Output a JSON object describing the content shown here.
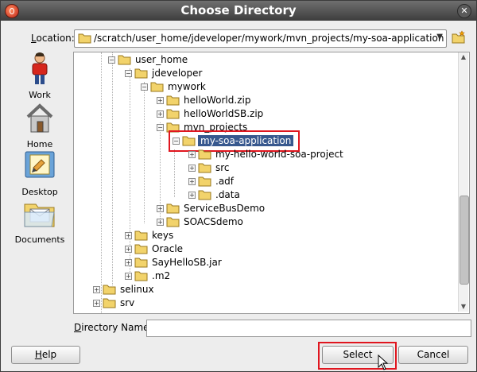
{
  "window": {
    "title": "Choose Directory"
  },
  "location": {
    "label_underlined": "L",
    "label_rest": "ocation:",
    "value": "/scratch/user_home/jdeveloper/mywork/mvn_projects/my-soa-application"
  },
  "shortcuts": [
    {
      "label": "Work",
      "icon": "work-icon"
    },
    {
      "label": "Home",
      "icon": "home-icon"
    },
    {
      "label": "Desktop",
      "icon": "desktop-icon"
    },
    {
      "label": "Documents",
      "icon": "documents-icon"
    }
  ],
  "tree": {
    "rows": [
      {
        "label": "user_home",
        "state": "expanded"
      },
      {
        "label": "jdeveloper",
        "state": "expanded"
      },
      {
        "label": "mywork",
        "state": "expanded"
      },
      {
        "label": "helloWorld.zip",
        "state": "collapsed"
      },
      {
        "label": "helloWorldSB.zip",
        "state": "collapsed"
      },
      {
        "label": "mvn_projects",
        "state": "expanded"
      },
      {
        "label": "my-soa-application",
        "state": "expanded",
        "selected": true
      },
      {
        "label": "my-hello-world-soa-project",
        "state": "collapsed"
      },
      {
        "label": "src",
        "state": "collapsed"
      },
      {
        "label": ".adf",
        "state": "collapsed"
      },
      {
        "label": ".data",
        "state": "collapsed"
      },
      {
        "label": "ServiceBusDemo",
        "state": "collapsed"
      },
      {
        "label": "SOACSdemo",
        "state": "collapsed"
      },
      {
        "label": "keys",
        "state": "collapsed"
      },
      {
        "label": "Oracle",
        "state": "collapsed"
      },
      {
        "label": "SayHelloSB.jar",
        "state": "collapsed"
      },
      {
        "label": ".m2",
        "state": "collapsed"
      },
      {
        "label": "selinux",
        "state": "collapsed"
      },
      {
        "label": "srv",
        "state": "collapsed"
      }
    ]
  },
  "directory_name": {
    "label_underlined": "D",
    "label_rest": "irectory Name:",
    "value": ""
  },
  "buttons": {
    "help_underlined": "H",
    "help_rest": "elp",
    "select": "Select",
    "cancel": "Cancel"
  },
  "colors": {
    "selection": "#37588e",
    "highlight_box": "#e0161f",
    "folder": "#f2d36b"
  }
}
